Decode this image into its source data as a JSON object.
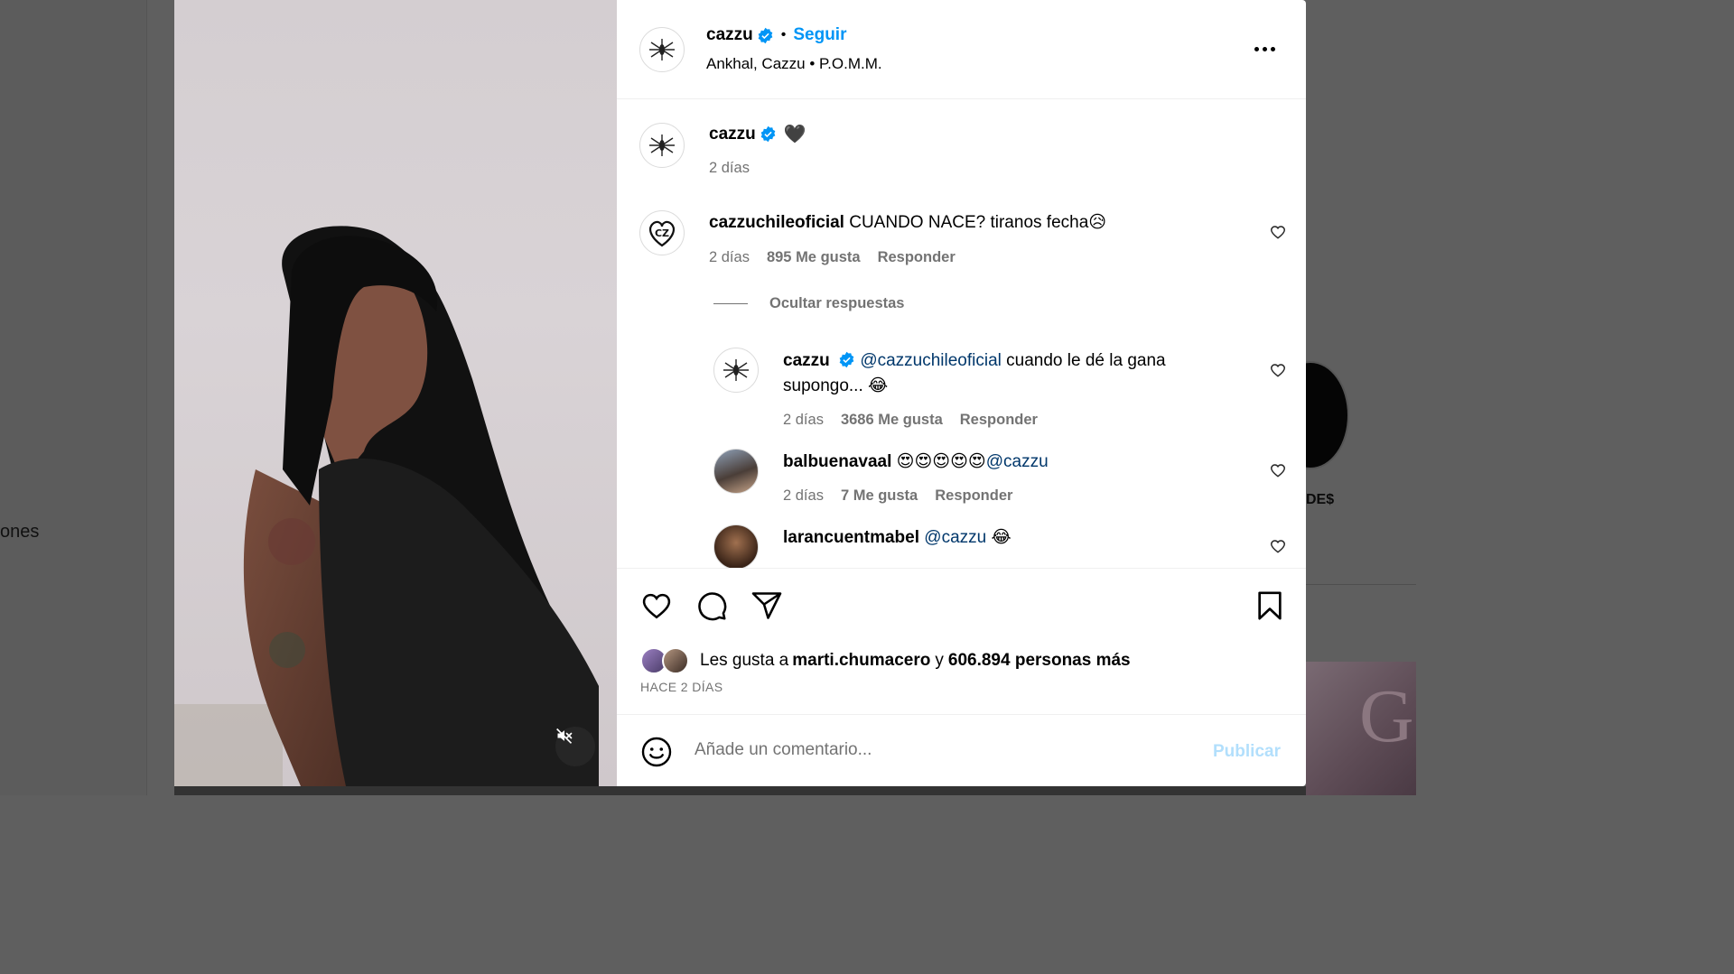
{
  "background": {
    "nav_text": "ones",
    "right_label": "DE$",
    "thumb_text": "G"
  },
  "post": {
    "author": "cazzu",
    "follow_label": "Seguir",
    "separator": "•",
    "audio": "Ankhal, Cazzu • P.O.M.M.",
    "caption_emoji": "🖤",
    "caption_time": "2 días"
  },
  "comments": [
    {
      "user": "cazzuchileoficial",
      "text": "CUANDO NACE? tiranos fecha😥",
      "time": "2 días",
      "likes": "895 Me gusta",
      "reply_label": "Responder",
      "toggle_replies": "Ocultar respuestas",
      "replies": [
        {
          "user": "cazzu",
          "mention": "@cazzuchileoficial",
          "text": " cuando le dé la gana supongo... 😂",
          "time": "2 días",
          "likes": "3686 Me gusta",
          "reply_label": "Responder"
        },
        {
          "user": "balbuenavaal",
          "text": "😍😍😍😍😍",
          "mention": "@cazzu",
          "time": "2 días",
          "likes": "7 Me gusta",
          "reply_label": "Responder"
        },
        {
          "user": "larancuentmabel",
          "mention": "@cazzu",
          "text": " 😂"
        }
      ]
    }
  ],
  "likes": {
    "prefix": "Les gusta a ",
    "user": "marti.chumacero",
    "connector": " y ",
    "count": "606.894 personas más"
  },
  "date_label": "HACE 2 DÍAS",
  "comment_box": {
    "placeholder": "Añade un comentario...",
    "publish_label": "Publicar"
  },
  "colors": {
    "accent": "#0095f6",
    "verified": "#0095f6",
    "publish_disabled": "#b2dffc",
    "muted_text": "#737373"
  },
  "icons": [
    "verified-icon",
    "more-options-icon",
    "heart-icon",
    "comment-icon",
    "share-icon",
    "bookmark-icon",
    "emoji-icon",
    "mute-icon"
  ]
}
